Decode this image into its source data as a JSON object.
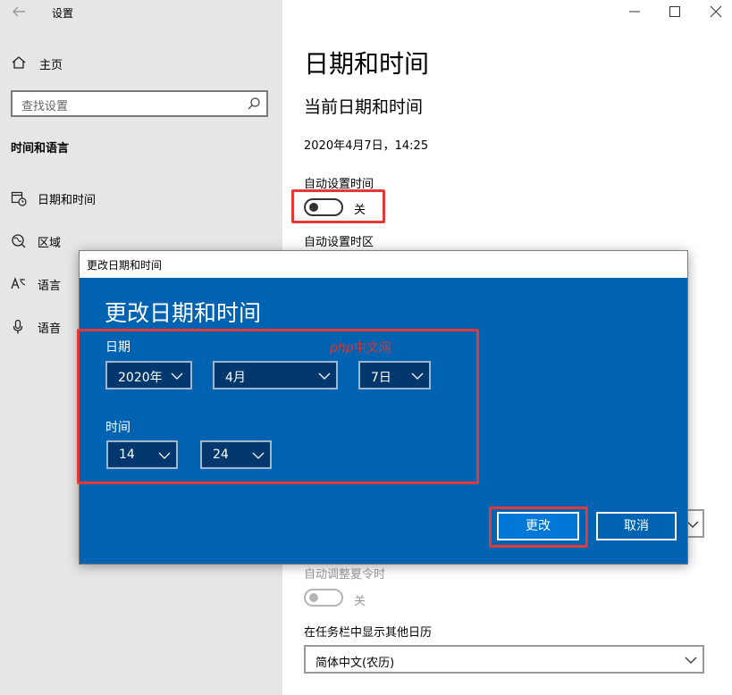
{
  "window": {
    "title": "设置"
  },
  "sidebar": {
    "home_label": "主页",
    "search_placeholder": "查找设置",
    "section_title": "时间和语言",
    "items": [
      {
        "label": "日期和时间",
        "icon": "calendar-clock-icon"
      },
      {
        "label": "区域",
        "icon": "globe-region-icon"
      },
      {
        "label": "语言",
        "icon": "language-icon"
      },
      {
        "label": "语音",
        "icon": "microphone-icon"
      }
    ]
  },
  "main": {
    "page_title": "日期和时间",
    "section_title": "当前日期和时间",
    "current_datetime": "2020年4月7日，14:25",
    "auto_time_label": "自动设置时间",
    "auto_time_state": "关",
    "auto_timezone_label": "自动设置时区",
    "dst_label": "自动调整夏令时",
    "dst_state": "关",
    "calendar_label": "在任务栏中显示其他日历",
    "calendar_value": "简体中文(农历)"
  },
  "dialog": {
    "window_title": "更改日期和时间",
    "heading": "更改日期和时间",
    "date_label": "日期",
    "year": "2020年",
    "month": "4月",
    "day": "7日",
    "time_label": "时间",
    "hour": "14",
    "minute": "24",
    "change_button": "更改",
    "cancel_button": "取消"
  },
  "watermark": {
    "brand": "php",
    "suffix": "中文网"
  },
  "colors": {
    "sidebar_bg": "#e6e6e6",
    "dialog_blue": "#0063b1",
    "dropdown_bg": "#02386e",
    "primary_button": "#0078d7",
    "highlight_red": "#e53935"
  }
}
